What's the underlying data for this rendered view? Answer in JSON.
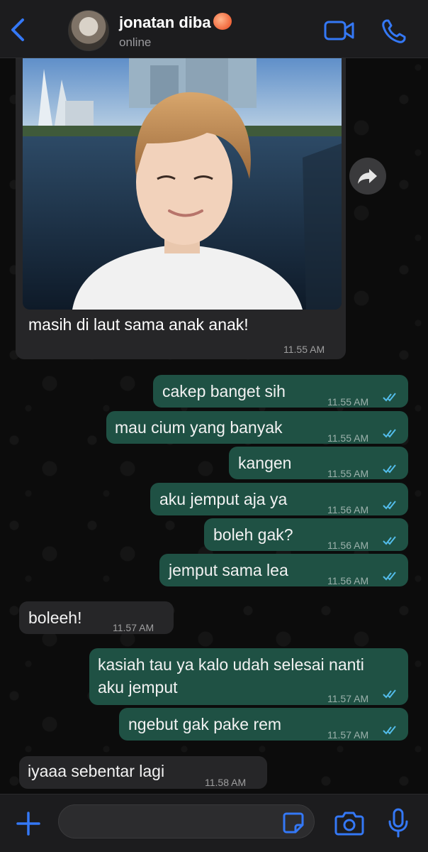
{
  "header": {
    "contact_name": "jonatan diba",
    "status": "online",
    "icons": {
      "back": "chevron-left-icon",
      "video": "video-camera-icon",
      "call": "phone-icon",
      "emoji": "peach-emoji-icon"
    }
  },
  "messages": [
    {
      "direction": "in",
      "type": "image",
      "caption": "masih di laut sama anak anak!",
      "time": "11.55 AM"
    },
    {
      "direction": "out",
      "text": "cakep banget sih",
      "time": "11.55 AM",
      "status": "read"
    },
    {
      "direction": "out",
      "text": "mau cium yang banyak",
      "time": "11.55 AM",
      "status": "read"
    },
    {
      "direction": "out",
      "text": "kangen",
      "time": "11.55 AM",
      "status": "read"
    },
    {
      "direction": "out",
      "text": "aku jemput aja ya",
      "time": "11.56 AM",
      "status": "read"
    },
    {
      "direction": "out",
      "text": "boleh gak?",
      "time": "11.56 AM",
      "status": "read"
    },
    {
      "direction": "out",
      "text": "jemput sama lea",
      "time": "11.56 AM",
      "status": "read"
    },
    {
      "direction": "in",
      "text": "boleeh!",
      "time": "11.57 AM"
    },
    {
      "direction": "out",
      "text_line1": "kasiah tau ya kalo udah selesai nanti",
      "text_line2": "aku jemput",
      "time": "11.57 AM",
      "status": "read"
    },
    {
      "direction": "out",
      "text": "ngebut gak pake rem",
      "time": "11.57 AM",
      "status": "read"
    },
    {
      "direction": "in",
      "text": "iyaaa sebentar lagi",
      "time": "11.58 AM"
    }
  ],
  "input_bar": {
    "placeholder": "",
    "icons": {
      "plus": "plus-icon",
      "sticker": "sticker-icon",
      "camera": "camera-icon",
      "mic": "microphone-icon"
    }
  },
  "colors": {
    "accent": "#3478f6",
    "outgoing_bubble": "#1f5144",
    "incoming_bubble": "#262628",
    "read_ticks": "#53bdeb",
    "background": "#0b0b0b"
  }
}
